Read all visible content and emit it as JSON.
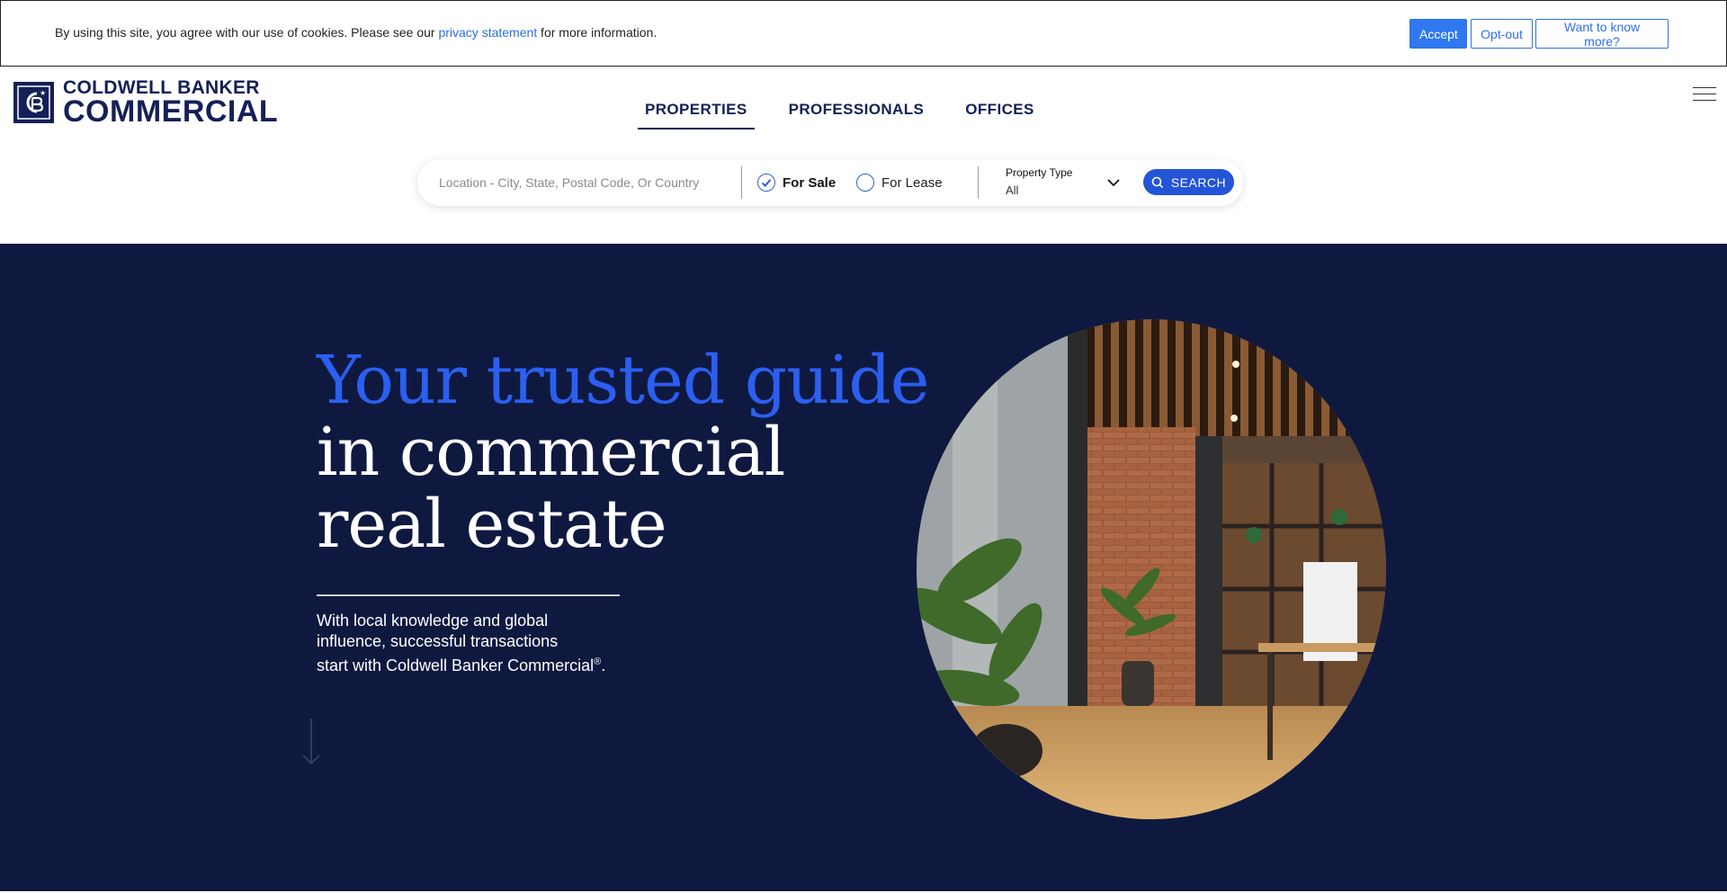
{
  "cookie": {
    "text_before": "By using this site, you agree with our use of cookies. Please see our ",
    "link": "privacy statement",
    "text_after": " for more information.",
    "accept": "Accept",
    "optout": "Opt-out",
    "more": "Want to know more?"
  },
  "brand": {
    "line1": "COLDWELL BANKER",
    "line2": "COMMERCIAL"
  },
  "nav": {
    "properties": "PROPERTIES",
    "professionals": "PROFESSIONALS",
    "offices": "OFFICES"
  },
  "search": {
    "location_placeholder": "Location - City, State, Postal Code, Or Country",
    "for_sale": "For Sale",
    "for_lease": "For Lease",
    "property_type_label": "Property Type",
    "property_type_value": "All",
    "button": "SEARCH"
  },
  "hero": {
    "line1": "Your trusted guide",
    "line2": "in commercial",
    "line3": "real estate",
    "sub1": "With local knowledge and global",
    "sub2": "influence, successful transactions",
    "sub3": "start with Coldwell Banker Commercial",
    "sub_mark": "®",
    "sub_end": "."
  },
  "colors": {
    "navy": "#0f1940",
    "brand_blue": "#142057",
    "accent": "#2b5ff0",
    "button": "#2454d8"
  },
  "icons": [
    "logo-cb-icon",
    "hamburger-icon",
    "check-icon",
    "chevron-down-icon",
    "search-icon",
    "arrow-down-icon"
  ]
}
